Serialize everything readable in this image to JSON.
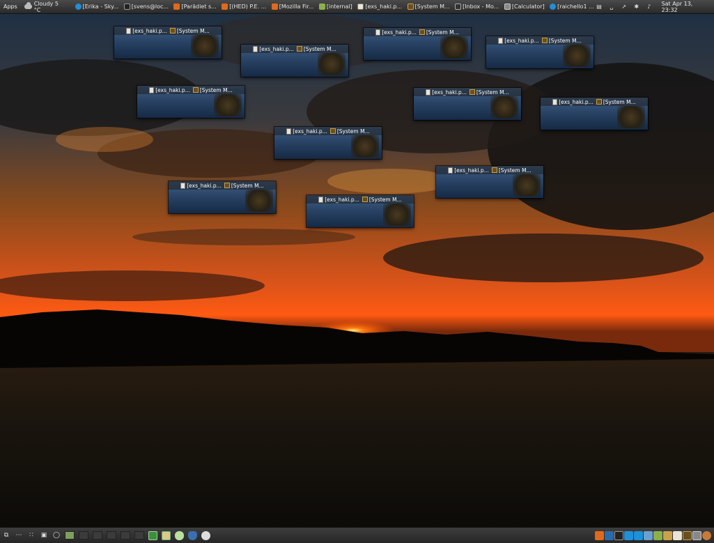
{
  "top_panel": {
    "apps_label": "Apps",
    "weather": "Cloudy 5 °C",
    "tasks": [
      {
        "label": "[Erika - Sky...",
        "icon": "skype-icon",
        "color": "#1e90d8"
      },
      {
        "label": "[svens@loc...",
        "icon": "terminal-icon",
        "color": "#222222"
      },
      {
        "label": "[Parädiet s...",
        "icon": "firefox-icon",
        "color": "#e06a1a"
      },
      {
        "label": "[(HED) P.E. ...",
        "icon": "firefox-icon",
        "color": "#e06a1a"
      },
      {
        "label": "[Mozilla Fir...",
        "icon": "firefox-icon",
        "color": "#e06a1a"
      },
      {
        "label": "[internal]",
        "icon": "folder-icon",
        "color": "#8bb04a"
      },
      {
        "label": "[exs_haki.p...",
        "icon": "document-icon",
        "color": "#e9e4d8"
      },
      {
        "label": "[System M...",
        "icon": "system-monitor-icon",
        "color": "#6a4e1e"
      },
      {
        "label": "[Inbox - Mo...",
        "icon": "mail-icon",
        "color": "#333333"
      },
      {
        "label": "[Calculator]",
        "icon": "calculator-icon",
        "color": "#888888"
      },
      {
        "label": "[raichello1 ...",
        "icon": "skype-icon",
        "color": "#1e90d8"
      }
    ],
    "clock": "Sat Apr 13, 23:32"
  },
  "thumbnails": {
    "window_a_label": "[exs_haki.p...",
    "window_b_label": "[System M..."
  },
  "bottom_panel": {
    "workspace_active_index": 0
  }
}
